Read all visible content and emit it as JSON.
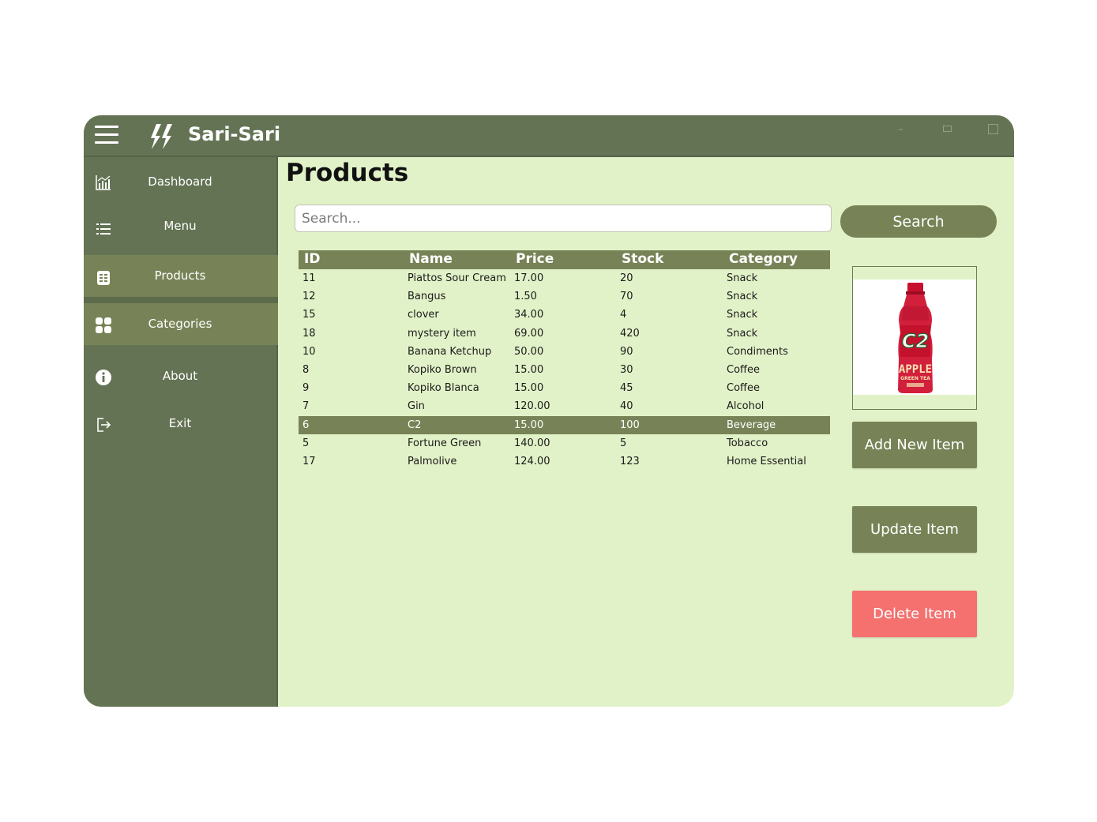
{
  "app": {
    "title": "Sari-Sari",
    "window_controls": {
      "minimize": "–"
    }
  },
  "sidebar": {
    "items": [
      {
        "label": "Dashboard",
        "icon": "chart-icon"
      },
      {
        "label": "Menu",
        "icon": "list-icon"
      },
      {
        "label": "Products",
        "icon": "table-icon",
        "active": true
      },
      {
        "label": "Categories",
        "icon": "grid-icon"
      },
      {
        "label": "About",
        "icon": "info-icon"
      },
      {
        "label": "Exit",
        "icon": "logout-icon"
      }
    ]
  },
  "main": {
    "title": "Products",
    "search": {
      "placeholder": "Search...",
      "value": "",
      "button_label": "Search"
    },
    "table": {
      "columns": [
        "ID",
        "Name",
        "Price",
        "Stock",
        "Category"
      ],
      "rows": [
        [
          "11",
          "Piattos Sour Cream",
          "17.00",
          "20",
          "Snack"
        ],
        [
          "12",
          "Bangus",
          "1.50",
          "70",
          "Snack"
        ],
        [
          "15",
          "clover",
          "34.00",
          "4",
          "Snack"
        ],
        [
          "18",
          "mystery item",
          "69.00",
          "420",
          "Snack"
        ],
        [
          "10",
          "Banana Ketchup",
          "50.00",
          "90",
          "Condiments"
        ],
        [
          "8",
          "Kopiko Brown",
          "15.00",
          "30",
          "Coffee"
        ],
        [
          "9",
          "Kopiko Blanca",
          "15.00",
          "45",
          "Coffee"
        ],
        [
          "7",
          "Gin",
          "120.00",
          "40",
          "Alcohol"
        ],
        [
          "6",
          "C2",
          "15.00",
          "100",
          "Beverage"
        ],
        [
          "5",
          "Fortune Green",
          "140.00",
          "5",
          "Tobacco"
        ],
        [
          "17",
          "Palmolive",
          "124.00",
          "123",
          "Home Essential"
        ]
      ],
      "selected_row": 8
    },
    "product_image": {
      "brand_text": "C2",
      "flavor_text": "APPLE",
      "sub_text": "GREEN TEA"
    },
    "buttons": {
      "add": "Add New Item",
      "update": "Update Item",
      "delete": "Delete Item"
    }
  },
  "colors": {
    "titlebar": "#647354",
    "sidebar": "#647354",
    "accent": "#778356",
    "content_bg": "#e2f2c8",
    "delete": "#f47170"
  }
}
